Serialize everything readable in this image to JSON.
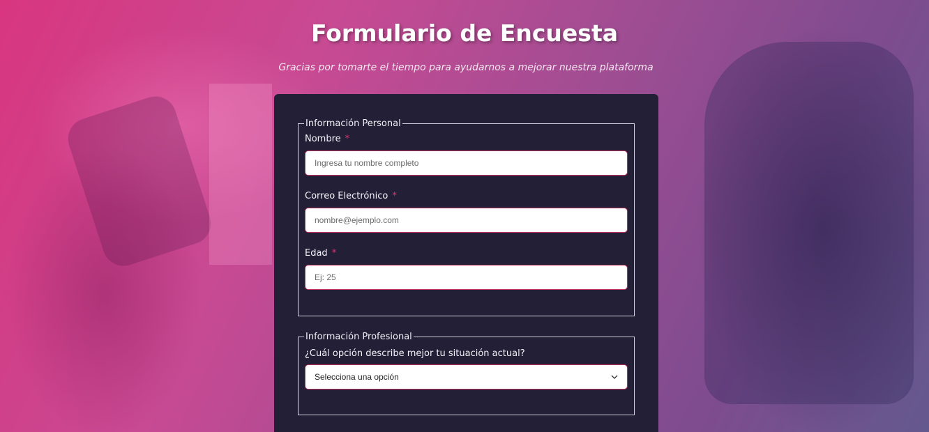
{
  "header": {
    "title": "Formulario de Encuesta",
    "subtitle": "Gracias por tomarte el tiempo para ayudarnos a mejorar nuestra plataforma"
  },
  "personal": {
    "legend": "Información Personal",
    "required_marker": "*",
    "name_label": "Nombre",
    "name_placeholder": "Ingresa tu nombre completo",
    "email_label": "Correo Electrónico",
    "email_placeholder": "nombre@ejemplo.com",
    "age_label": "Edad",
    "age_placeholder": "Ej: 25"
  },
  "professional": {
    "legend": "Información Profesional",
    "situation_label": "¿Cuál opción describe mejor tu situación actual?",
    "situation_selected": "Selecciona una opción",
    "icon": "chevron-down-icon"
  },
  "colors": {
    "card_bg": "#221f36",
    "accent": "#c0305f",
    "required": "#e6336f"
  }
}
